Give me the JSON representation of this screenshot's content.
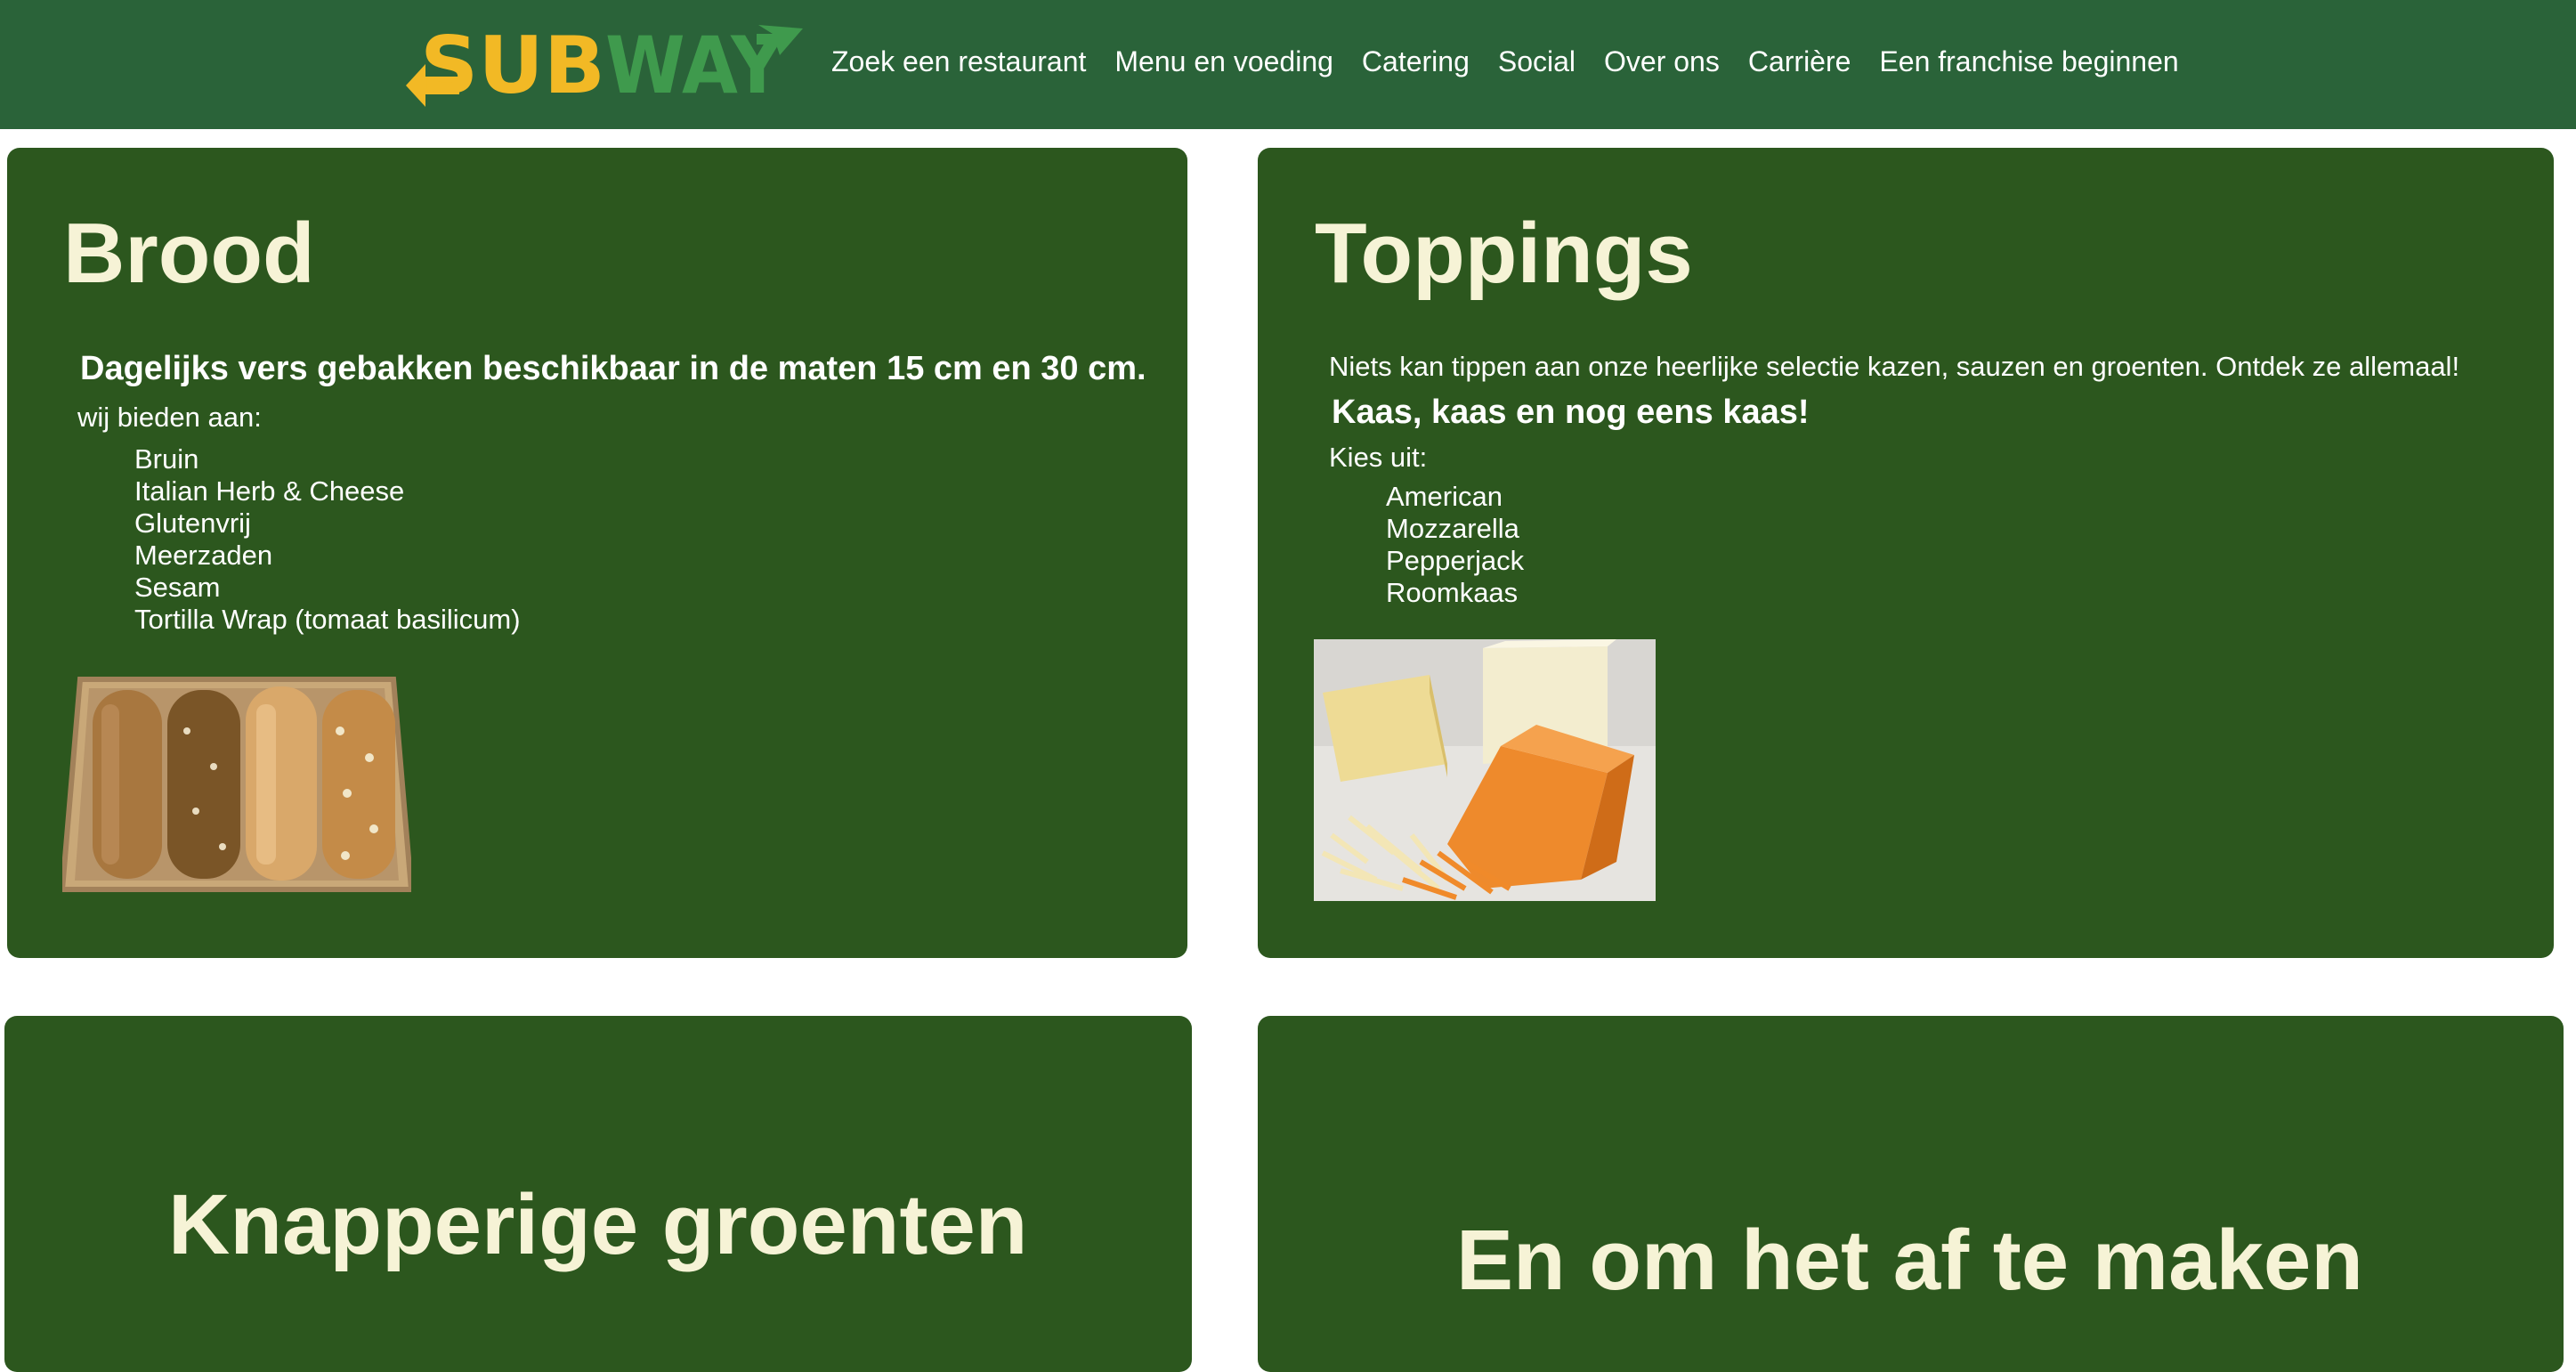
{
  "header": {
    "logo_text": "SUBWAY",
    "nav": [
      "Zoek een restaurant",
      "Menu en voeding",
      "Catering",
      "Social",
      "Over ons",
      "Carrière",
      "Een franchise beginnen"
    ]
  },
  "sections": {
    "brood": {
      "title": "Brood",
      "subtitle": "Dagelijks vers gebakken beschikbaar in de maten 15 cm en 30 cm.",
      "intro": "wij bieden aan:",
      "items": [
        "Bruin",
        "Italian Herb & Cheese",
        "Glutenvrij",
        "Meerzaden",
        "Sesam",
        "Tortilla Wrap (tomaat basilicum)"
      ]
    },
    "toppings": {
      "title": "Toppings",
      "intro": "Niets kan tippen aan onze heerlijke selectie kazen, sauzen en groenten. Ontdek ze allemaal!",
      "subtitle": "Kaas, kaas en nog eens kaas!",
      "choose": "Kies uit:",
      "items": [
        "American",
        "Mozzarella",
        "Pepperjack",
        "Roomkaas"
      ]
    },
    "groenten": {
      "title": "Knapperige groenten"
    },
    "afmaken": {
      "title": "En om het af te maken"
    }
  },
  "colors": {
    "nav_background": "#2a6339",
    "card_background": "#2c571e",
    "title_color": "#f6f3d6",
    "logo_yellow": "#f2b925",
    "logo_green": "#3f9a4d"
  },
  "icons": {
    "logo": "subway-logo"
  }
}
